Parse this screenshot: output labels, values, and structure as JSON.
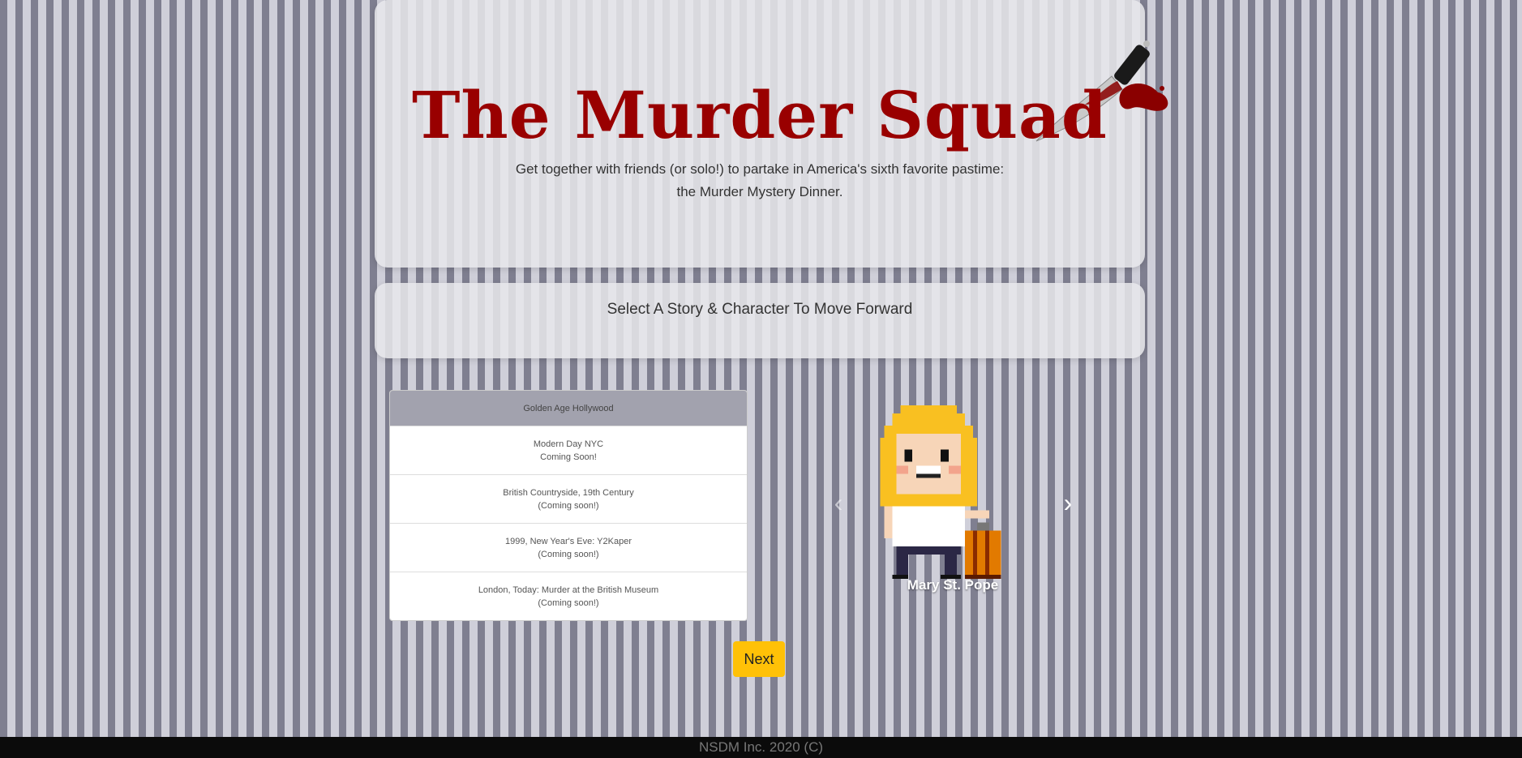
{
  "header": {
    "title": "The Murder Squad",
    "tagline_line1": "Get together with friends (or solo!) to partake in America's sixth favorite pastime:",
    "tagline_line2": "the Murder Mystery Dinner."
  },
  "instructions": "Select A Story & Character To Move Forward",
  "stories": [
    {
      "line1": "Golden Age Hollywood",
      "line2": ""
    },
    {
      "line1": "Modern Day NYC",
      "line2": "Coming Soon!"
    },
    {
      "line1": "British Countryside, 19th Century",
      "line2": "(Coming soon!)"
    },
    {
      "line1": "1999, New Year's Eve: Y2Kaper",
      "line2": "(Coming soon!)"
    },
    {
      "line1": "London, Today: Murder at the British Museum",
      "line2": "(Coming soon!)"
    }
  ],
  "character": {
    "name": "Mary St. Pope"
  },
  "next_label": "Next",
  "footer": "NSDM Inc. 2020 (C)",
  "colors": {
    "title": "#990000",
    "button": "#ffc107",
    "footer": "#0b0b0b"
  },
  "icons": {
    "prev": "chevron-left-icon",
    "next": "chevron-right-icon",
    "logo": "bloody-knife-icon"
  }
}
